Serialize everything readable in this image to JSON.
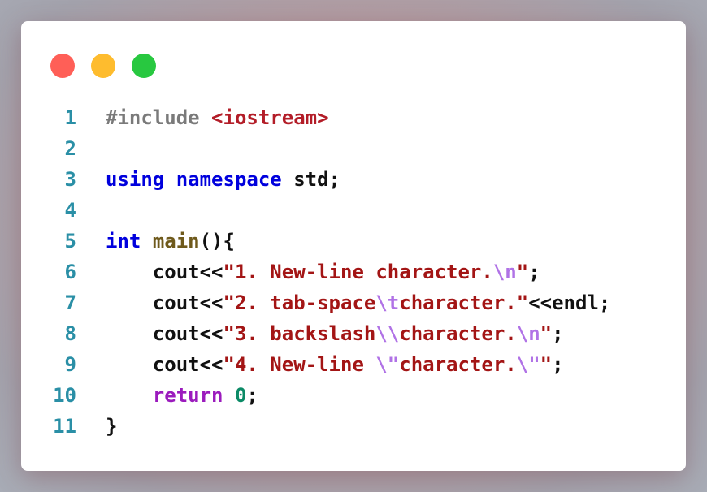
{
  "window": {
    "controls": {
      "close_color": "#ff5f57",
      "minimize_color": "#febc2e",
      "maximize_color": "#28c840"
    }
  },
  "code": {
    "lines": [
      {
        "number": "1",
        "tokens": [
          {
            "text": "#include ",
            "kind": "pp"
          },
          {
            "text": "<iostream>",
            "kind": "hdr"
          }
        ]
      },
      {
        "number": "2",
        "tokens": []
      },
      {
        "number": "3",
        "tokens": [
          {
            "text": "using",
            "kind": "kw"
          },
          {
            "text": " ",
            "kind": "plain"
          },
          {
            "text": "namespace",
            "kind": "kw"
          },
          {
            "text": " std;",
            "kind": "plain"
          }
        ]
      },
      {
        "number": "4",
        "tokens": []
      },
      {
        "number": "5",
        "tokens": [
          {
            "text": "int",
            "kind": "kw"
          },
          {
            "text": " ",
            "kind": "plain"
          },
          {
            "text": "main",
            "kind": "fn"
          },
          {
            "text": "(){",
            "kind": "plain"
          }
        ]
      },
      {
        "number": "6",
        "tokens": [
          {
            "text": "    cout<<",
            "kind": "plain"
          },
          {
            "text": "\"1. New-line character.",
            "kind": "str"
          },
          {
            "text": "\\n",
            "kind": "esc"
          },
          {
            "text": "\"",
            "kind": "str"
          },
          {
            "text": ";",
            "kind": "plain"
          }
        ]
      },
      {
        "number": "7",
        "tokens": [
          {
            "text": "    cout<<",
            "kind": "plain"
          },
          {
            "text": "\"2. tab-space",
            "kind": "str"
          },
          {
            "text": "\\t",
            "kind": "esc"
          },
          {
            "text": "character.\"",
            "kind": "str"
          },
          {
            "text": "<<endl;",
            "kind": "plain"
          }
        ]
      },
      {
        "number": "8",
        "tokens": [
          {
            "text": "    cout<<",
            "kind": "plain"
          },
          {
            "text": "\"3. backslash",
            "kind": "str"
          },
          {
            "text": "\\\\",
            "kind": "esc"
          },
          {
            "text": "character.",
            "kind": "str"
          },
          {
            "text": "\\n",
            "kind": "esc"
          },
          {
            "text": "\"",
            "kind": "str"
          },
          {
            "text": ";",
            "kind": "plain"
          }
        ]
      },
      {
        "number": "9",
        "tokens": [
          {
            "text": "    cout<<",
            "kind": "plain"
          },
          {
            "text": "\"4. New-line ",
            "kind": "str"
          },
          {
            "text": "\\\"",
            "kind": "esc"
          },
          {
            "text": "character.",
            "kind": "str"
          },
          {
            "text": "\\\"",
            "kind": "esc"
          },
          {
            "text": "\"",
            "kind": "str"
          },
          {
            "text": ";",
            "kind": "plain"
          }
        ]
      },
      {
        "number": "10",
        "tokens": [
          {
            "text": "    ",
            "kind": "plain"
          },
          {
            "text": "return",
            "kind": "ret"
          },
          {
            "text": " ",
            "kind": "plain"
          },
          {
            "text": "0",
            "kind": "num"
          },
          {
            "text": ";",
            "kind": "plain"
          }
        ]
      },
      {
        "number": "11",
        "tokens": [
          {
            "text": "}",
            "kind": "plain"
          }
        ]
      }
    ]
  }
}
